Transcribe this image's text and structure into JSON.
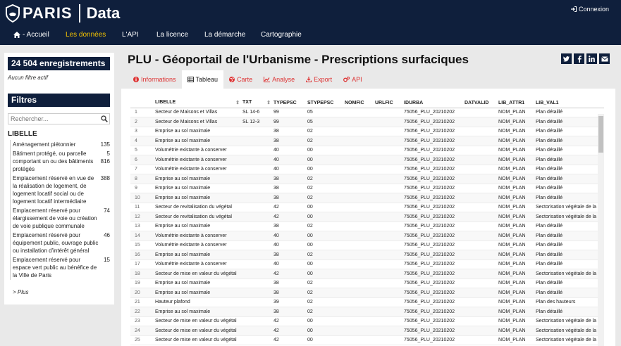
{
  "header": {
    "brand": "PARIS",
    "product": "Data",
    "login_label": "Connexion"
  },
  "nav": {
    "items": [
      {
        "label": "- Accueil"
      },
      {
        "label": "Les données"
      },
      {
        "label": "L'API"
      },
      {
        "label": "La licence"
      },
      {
        "label": "La démarche"
      },
      {
        "label": "Cartographie"
      }
    ],
    "active": "Les données"
  },
  "sidebar": {
    "count": "24 504 enregistrements",
    "no_filter": "Aucun filtre actif",
    "filters_title": "Filtres",
    "search_placeholder": "Rechercher...",
    "facet_title": "LIBELLE",
    "facets": [
      {
        "label": "Aménagement piétonnier",
        "count": "135"
      },
      {
        "label": "Bâtiment protégé, ou parcelle comportant un ou des bâtiments protégés",
        "count": "5 816"
      },
      {
        "label": "Emplacement réservé en vue de la réalisation de logement, de logement locatif social ou de logement locatif intermédiaire",
        "count": "388"
      },
      {
        "label": "Emplacement réservé pour élargissement de voie ou création de voie publique communale",
        "count": "74"
      },
      {
        "label": "Emplacement réservé pour équipement public, ouvrage public ou installation d'intérêt général",
        "count": "46"
      },
      {
        "label": "Emplacement réservé pour espace vert public au bénéfice de la Ville de Paris",
        "count": "15"
      }
    ],
    "more": "> Plus"
  },
  "page": {
    "title": "PLU - Géoportail de l'Urbanisme - Prescriptions surfaciques"
  },
  "tabs": [
    {
      "label": "Informations",
      "icon": "info-icon"
    },
    {
      "label": "Tableau",
      "icon": "table-icon"
    },
    {
      "label": "Carte",
      "icon": "globe-icon"
    },
    {
      "label": "Analyse",
      "icon": "chart-icon"
    },
    {
      "label": "Export",
      "icon": "download-icon"
    },
    {
      "label": "API",
      "icon": "cogs-icon"
    }
  ],
  "active_tab": "Tableau",
  "colors": {
    "navy": "#0f1f3c",
    "accent_yellow": "#f5c400",
    "tab_red": "#dd3333"
  },
  "table": {
    "columns": [
      "LIBELLE",
      "TXT",
      "TYPEPSC",
      "STYPEPSC",
      "NOMFIC",
      "URLFIC",
      "IDURBA",
      "DATVALID",
      "LIB_ATTR1",
      "LIB_VAL1"
    ],
    "rows": [
      [
        "1",
        "Secteur de Maisons et Villas",
        "SL 14-6",
        "99",
        "05",
        "",
        "",
        "75056_PLU_20210202",
        "",
        "NOM_PLAN",
        "Plan détaillé"
      ],
      [
        "2",
        "Secteur de Maisons et Villas",
        "SL 12-3",
        "99",
        "05",
        "",
        "",
        "75056_PLU_20210202",
        "",
        "NOM_PLAN",
        "Plan détaillé"
      ],
      [
        "3",
        "Emprise au sol maximale",
        "",
        "38",
        "02",
        "",
        "",
        "75056_PLU_20210202",
        "",
        "NOM_PLAN",
        "Plan détaillé"
      ],
      [
        "4",
        "Emprise au sol maximale",
        "",
        "38",
        "02",
        "",
        "",
        "75056_PLU_20210202",
        "",
        "NOM_PLAN",
        "Plan détaillé"
      ],
      [
        "5",
        "Volumétrie existante à conserver",
        "",
        "40",
        "00",
        "",
        "",
        "75056_PLU_20210202",
        "",
        "NOM_PLAN",
        "Plan détaillé"
      ],
      [
        "6",
        "Volumétrie existante à conserver",
        "",
        "40",
        "00",
        "",
        "",
        "75056_PLU_20210202",
        "",
        "NOM_PLAN",
        "Plan détaillé"
      ],
      [
        "7",
        "Volumétrie existante à conserver",
        "",
        "40",
        "00",
        "",
        "",
        "75056_PLU_20210202",
        "",
        "NOM_PLAN",
        "Plan détaillé"
      ],
      [
        "8",
        "Emprise au sol maximale",
        "",
        "38",
        "02",
        "",
        "",
        "75056_PLU_20210202",
        "",
        "NOM_PLAN",
        "Plan détaillé"
      ],
      [
        "9",
        "Emprise au sol maximale",
        "",
        "38",
        "02",
        "",
        "",
        "75056_PLU_20210202",
        "",
        "NOM_PLAN",
        "Plan détaillé"
      ],
      [
        "10",
        "Emprise au sol maximale",
        "",
        "38",
        "02",
        "",
        "",
        "75056_PLU_20210202",
        "",
        "NOM_PLAN",
        "Plan détaillé"
      ],
      [
        "11",
        "Secteur de revitalisation du végétal",
        "",
        "42",
        "00",
        "",
        "",
        "75056_PLU_20210202",
        "",
        "NOM_PLAN",
        "Sectorisation végétale de la z"
      ],
      [
        "12",
        "Secteur de revitalisation du végétal",
        "",
        "42",
        "00",
        "",
        "",
        "75056_PLU_20210202",
        "",
        "NOM_PLAN",
        "Sectorisation végétale de la z"
      ],
      [
        "13",
        "Emprise au sol maximale",
        "",
        "38",
        "02",
        "",
        "",
        "75056_PLU_20210202",
        "",
        "NOM_PLAN",
        "Plan détaillé"
      ],
      [
        "14",
        "Volumétrie existante à conserver",
        "",
        "40",
        "00",
        "",
        "",
        "75056_PLU_20210202",
        "",
        "NOM_PLAN",
        "Plan détaillé"
      ],
      [
        "15",
        "Volumétrie existante à conserver",
        "",
        "40",
        "00",
        "",
        "",
        "75056_PLU_20210202",
        "",
        "NOM_PLAN",
        "Plan détaillé"
      ],
      [
        "16",
        "Emprise au sol maximale",
        "",
        "38",
        "02",
        "",
        "",
        "75056_PLU_20210202",
        "",
        "NOM_PLAN",
        "Plan détaillé"
      ],
      [
        "17",
        "Volumétrie existante à conserver",
        "",
        "40",
        "00",
        "",
        "",
        "75056_PLU_20210202",
        "",
        "NOM_PLAN",
        "Plan détaillé"
      ],
      [
        "18",
        "Secteur de mise en valeur du végétal",
        "",
        "42",
        "00",
        "",
        "",
        "75056_PLU_20210202",
        "",
        "NOM_PLAN",
        "Sectorisation végétale de la z"
      ],
      [
        "19",
        "Emprise au sol maximale",
        "",
        "38",
        "02",
        "",
        "",
        "75056_PLU_20210202",
        "",
        "NOM_PLAN",
        "Plan détaillé"
      ],
      [
        "20",
        "Emprise au sol maximale",
        "",
        "38",
        "02",
        "",
        "",
        "75056_PLU_20210202",
        "",
        "NOM_PLAN",
        "Plan détaillé"
      ],
      [
        "21",
        "Hauteur plafond",
        "",
        "39",
        "02",
        "",
        "",
        "75056_PLU_20210202",
        "",
        "NOM_PLAN",
        "Plan des hauteurs"
      ],
      [
        "22",
        "Emprise au sol maximale",
        "",
        "38",
        "02",
        "",
        "",
        "75056_PLU_20210202",
        "",
        "NOM_PLAN",
        "Plan détaillé"
      ],
      [
        "23",
        "Secteur de mise en valeur du végétal",
        "",
        "42",
        "00",
        "",
        "",
        "75056_PLU_20210202",
        "",
        "NOM_PLAN",
        "Sectorisation végétale de la z"
      ],
      [
        "24",
        "Secteur de mise en valeur du végétal",
        "",
        "42",
        "00",
        "",
        "",
        "75056_PLU_20210202",
        "",
        "NOM_PLAN",
        "Sectorisation végétale de la z"
      ],
      [
        "25",
        "Secteur de mise en valeur du végétal",
        "",
        "42",
        "00",
        "",
        "",
        "75056_PLU_20210202",
        "",
        "NOM_PLAN",
        "Sectorisation végétale de la z"
      ]
    ]
  }
}
